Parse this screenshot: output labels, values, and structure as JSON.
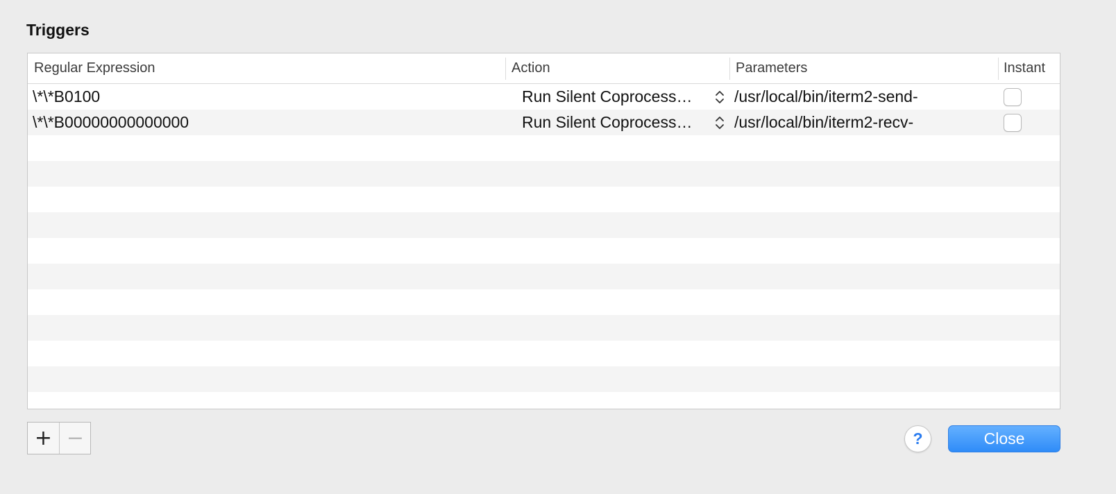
{
  "dialog": {
    "title": "Triggers"
  },
  "table": {
    "columns": [
      {
        "label": "Regular Expression"
      },
      {
        "label": "Action"
      },
      {
        "label": "Parameters"
      },
      {
        "label": "Instant"
      }
    ],
    "rows": [
      {
        "regex": "\\*\\*B0100",
        "action": "Run Silent Coprocess…",
        "parameters": "/usr/local/bin/iterm2-send-",
        "instant": false
      },
      {
        "regex": "\\*\\*B00000000000000",
        "action": "Run Silent Coprocess…",
        "parameters": "/usr/local/bin/iterm2-recv-",
        "instant": false
      }
    ],
    "empty_row_count": 10
  },
  "footer": {
    "add_label": "+",
    "remove_label": "−",
    "help_label": "?",
    "close_label": "Close"
  },
  "icons": {
    "stepper": "up-down-chevron-icon"
  },
  "colors": {
    "accent": "#2f8cf8",
    "help_text": "#2a7cf0"
  }
}
